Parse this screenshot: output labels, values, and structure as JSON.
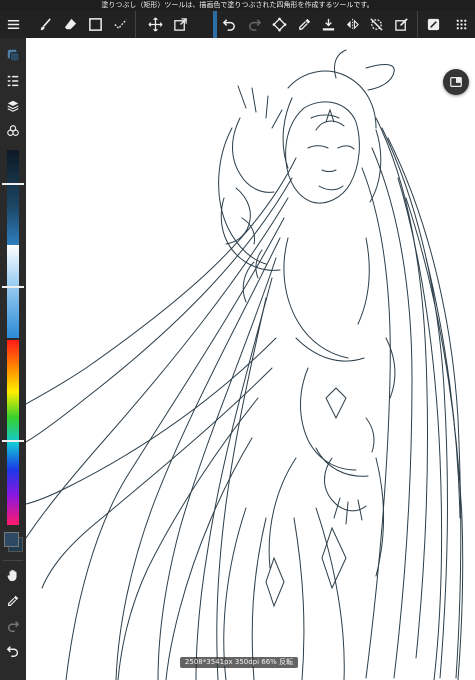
{
  "hint_bar": {
    "text": "塗りつぶし（矩形）ツールは、描画色で塗りつぶされた四角形を作成するツールです。"
  },
  "toolbar_left": [
    {
      "name": "menu-icon"
    },
    {
      "name": "brush-icon"
    },
    {
      "name": "eraser-icon"
    },
    {
      "name": "rectangle-icon"
    },
    {
      "name": "selection-pen-icon"
    },
    {
      "name": "move-icon"
    },
    {
      "name": "transform-icon"
    }
  ],
  "toolbar_right": [
    {
      "name": "undo-icon"
    },
    {
      "name": "redo-icon"
    },
    {
      "name": "free-transform-icon"
    },
    {
      "name": "eyedropper-icon"
    },
    {
      "name": "fill-icon"
    },
    {
      "name": "flip-horizontal-icon"
    },
    {
      "name": "snap-off-icon"
    },
    {
      "name": "edit-icon"
    },
    {
      "name": "edit-square-icon"
    },
    {
      "name": "grid-menu-icon"
    }
  ],
  "left_panel": {
    "tools": [
      {
        "name": "color-swatch-icon"
      },
      {
        "name": "brush-list-icon"
      },
      {
        "name": "layers-icon"
      },
      {
        "name": "materials-icon"
      }
    ],
    "sliders": [
      {
        "name": "brush-size-slider",
        "value": 0.3
      },
      {
        "name": "brush-opacity-slider",
        "value": 0.45
      },
      {
        "name": "hue-slider",
        "value": 0.55
      }
    ],
    "colors": {
      "foreground": "#2c4a63",
      "background": "#2a2a2a"
    },
    "bottom_tools": [
      {
        "name": "hand-icon"
      },
      {
        "name": "eyedropper-icon"
      },
      {
        "name": "redo-icon"
      },
      {
        "name": "undo-icon"
      }
    ]
  },
  "canvas": {
    "status": "2508*3541px 350dpi 66% 反転"
  },
  "fab": {
    "name": "panel-icon"
  },
  "colors": {
    "ui_dark": "#222222",
    "line_art": "#2c3e4a",
    "accent_blue": "#2d6ea4"
  }
}
